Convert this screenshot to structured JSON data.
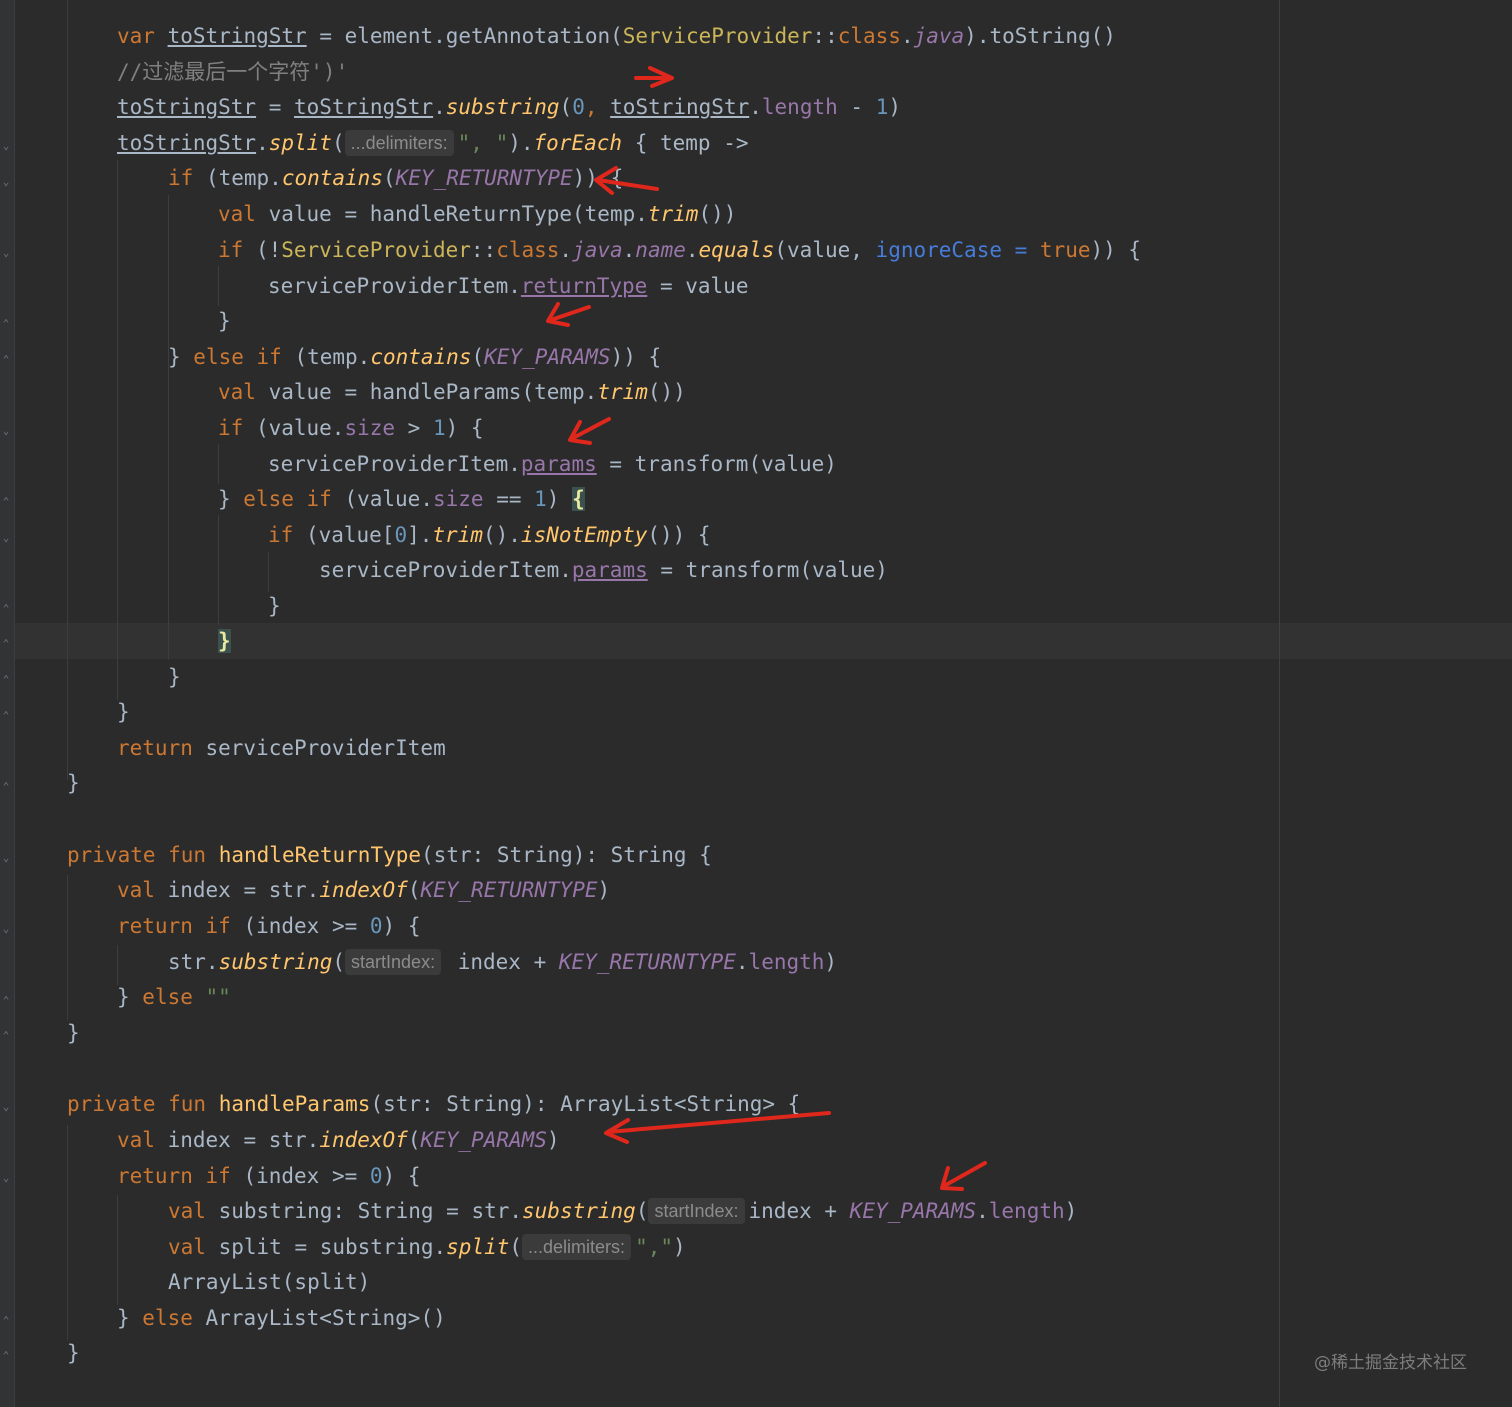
{
  "editor": {
    "lines": [
      {
        "id": "l1",
        "kw_var": "var",
        "var_name": "toStringStr",
        "eq": " = ",
        "recv": "element.getAnnotation(",
        "cls": "ServiceProvider",
        "sep": "::",
        "cls_kw": "class",
        "dot": ".",
        "java": "java",
        "tail": ").toString()"
      },
      {
        "id": "l2",
        "comment": "//过滤最后一个字符')'"
      },
      {
        "id": "l3",
        "a": "toStringStr",
        "eq": " = ",
        "b": "toStringStr",
        "dot": ".",
        "call": "substring",
        "open": "(",
        "zero": "0",
        "comma": ", ",
        "c": "toStringStr",
        "dot2": ".",
        "prop": "length",
        "minus": " - ",
        "one": "1",
        "close": ")"
      },
      {
        "id": "l4",
        "a": "toStringStr",
        "dot": ".",
        "call": "split",
        "open": "(",
        "hint": "...delimiters:",
        "str": "\", \"",
        "close": ")",
        "dot2": ".",
        "call2": "forEach",
        "rest": " { temp ->"
      },
      {
        "id": "l5",
        "kw": "if",
        "pre": " (temp.",
        "call": "contains",
        "open": "(",
        "const": "KEY_RETURNTYPE",
        "rest": ")) {"
      },
      {
        "id": "l6",
        "kw": "val",
        "pre": " value = handleReturnType(temp.",
        "call": "trim",
        "rest": "())"
      },
      {
        "id": "l7",
        "kw": "if",
        "pre": " (!",
        "cls": "ServiceProvider",
        "sep": "::",
        "cls_kw": "class",
        "dot": ".",
        "java": "java",
        "dot2": ".",
        "name": "name",
        "dot3": ".",
        "call": "equals",
        "mid": "(value, ",
        "named": "ignoreCase = ",
        "true": "true",
        "rest": ")) {"
      },
      {
        "id": "l8",
        "pre": "serviceProviderItem.",
        "prop": "returnType",
        "rest": " = value"
      },
      {
        "id": "l9",
        "text": "}"
      },
      {
        "id": "l10",
        "pre": "} ",
        "kw": "else if",
        "mid": " (temp.",
        "call": "contains",
        "open": "(",
        "const": "KEY_PARAMS",
        "rest": ")) {"
      },
      {
        "id": "l11",
        "kw": "val",
        "pre": " value = handleParams(temp.",
        "call": "trim",
        "rest": "())"
      },
      {
        "id": "l12",
        "kw": "if",
        "pre": " (value.",
        "prop": "size",
        "mid": " > ",
        "num": "1",
        "rest": ") {"
      },
      {
        "id": "l13",
        "pre": "serviceProviderItem.",
        "prop": "params",
        "rest": " = transform(value)"
      },
      {
        "id": "l14",
        "pre": "} ",
        "kw": "else if",
        "mid": " (value.",
        "prop": "size",
        "mid2": " == ",
        "num": "1",
        "rest": ") ",
        "brace": "{"
      },
      {
        "id": "l15",
        "kw": "if",
        "pre": " (value[",
        "num": "0",
        "mid": "].",
        "call": "trim",
        "mid2": "().",
        "call2": "isNotEmpty",
        "rest": "()) {"
      },
      {
        "id": "l16",
        "pre": "serviceProviderItem.",
        "prop": "params",
        "rest": " = transform(value)"
      },
      {
        "id": "l17",
        "text": "}"
      },
      {
        "id": "l18",
        "brace": "}"
      },
      {
        "id": "l19",
        "text": "}"
      },
      {
        "id": "l20",
        "text": "}"
      },
      {
        "id": "l21",
        "kw": "return",
        "rest": " serviceProviderItem"
      },
      {
        "id": "l22",
        "text": "}"
      },
      {
        "id": "l23",
        "kw": "private fun",
        "sp": " ",
        "fn": "handleReturnType",
        "rest": "(str: String): String {"
      },
      {
        "id": "l24",
        "kw": "val",
        "pre": " index = str.",
        "call": "indexOf",
        "open": "(",
        "const": "KEY_RETURNTYPE",
        "rest": ")"
      },
      {
        "id": "l25",
        "kw": "return if",
        "pre": " (index >= ",
        "num": "0",
        "rest": ") {"
      },
      {
        "id": "l26",
        "pre": "str.",
        "call": "substring",
        "open": "(",
        "hint": "startIndex:",
        "mid": " index + ",
        "const": "KEY_RETURNTYPE",
        "dot": ".",
        "prop": "length",
        "rest": ")"
      },
      {
        "id": "l27",
        "pre": "} ",
        "kw": "else",
        "rest": " ",
        "str": "\"\""
      },
      {
        "id": "l28",
        "text": "}"
      },
      {
        "id": "l29",
        "kw": "private fun",
        "sp": " ",
        "fn": "handleParams",
        "rest": "(str: String): ArrayList<String> {"
      },
      {
        "id": "l30",
        "kw": "val",
        "pre": " index = str.",
        "call": "indexOf",
        "open": "(",
        "const": "KEY_PARAMS",
        "rest": ")"
      },
      {
        "id": "l31",
        "kw": "return if",
        "pre": " (index >= ",
        "num": "0",
        "rest": ") {"
      },
      {
        "id": "l32",
        "kw": "val",
        "pre": " substring: String = str.",
        "call": "substring",
        "open": "(",
        "hint": "startIndex:",
        "mid": "index + ",
        "const": "KEY_PARAMS",
        "dot": ".",
        "prop": "length",
        "rest": ")"
      },
      {
        "id": "l33",
        "kw": "val",
        "pre": " split = substring.",
        "call": "split",
        "open": "(",
        "hint": "...delimiters:",
        "str": "\",\"",
        "rest": ")"
      },
      {
        "id": "l34",
        "text": "ArrayList(split)"
      },
      {
        "id": "l35",
        "pre": "} ",
        "kw": "else",
        "rest": " ArrayList<String>()"
      },
      {
        "id": "l36",
        "text": "}"
      }
    ]
  },
  "colors": {
    "background": "#2b2b2b",
    "keyword": "#cc7832",
    "function": "#ffc66d",
    "number": "#6897bb",
    "string": "#6a8759",
    "comment": "#808080",
    "property": "#9876aa",
    "annotation_arrow": "#e0271c"
  },
  "watermark": "@稀土掘金技术社区"
}
